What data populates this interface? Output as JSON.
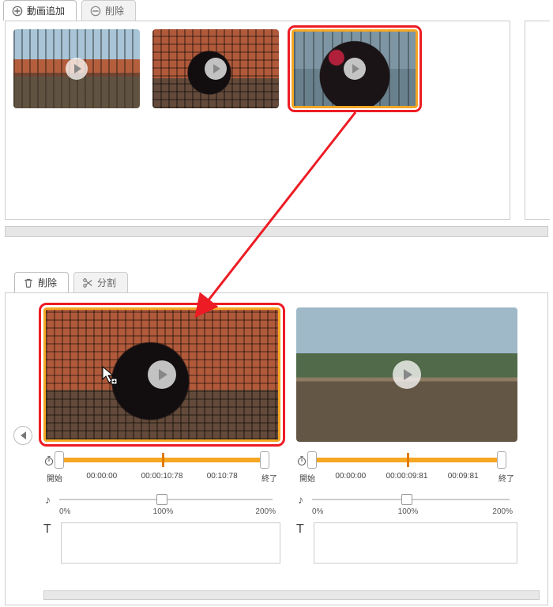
{
  "topTabs": {
    "addVideo": "動画追加",
    "delete": "削除"
  },
  "bottomTabs": {
    "delete": "削除",
    "split": "分割"
  },
  "timelineClips": [
    {
      "startLabel": "開始",
      "startTime": "00:00:00",
      "midTime": "00:00:10:78",
      "endTime": "00:10:78",
      "endLabel": "終了",
      "speed0": "0%",
      "speed100": "100%",
      "speed200": "200%",
      "textLabel": "T",
      "textValue": ""
    },
    {
      "startLabel": "開始",
      "startTime": "00:00:00",
      "midTime": "00:00:09:81",
      "endTime": "00:09:81",
      "endLabel": "終了",
      "speed0": "0%",
      "speed100": "100%",
      "speed200": "200%",
      "textLabel": "T",
      "textValue": ""
    }
  ],
  "icons": {
    "plus": "plus-circle-icon",
    "minus": "minus-circle-icon",
    "trash": "trash-icon",
    "scissors": "scissors-icon",
    "stopwatch": "stopwatch-icon",
    "note": "music-note-icon"
  }
}
